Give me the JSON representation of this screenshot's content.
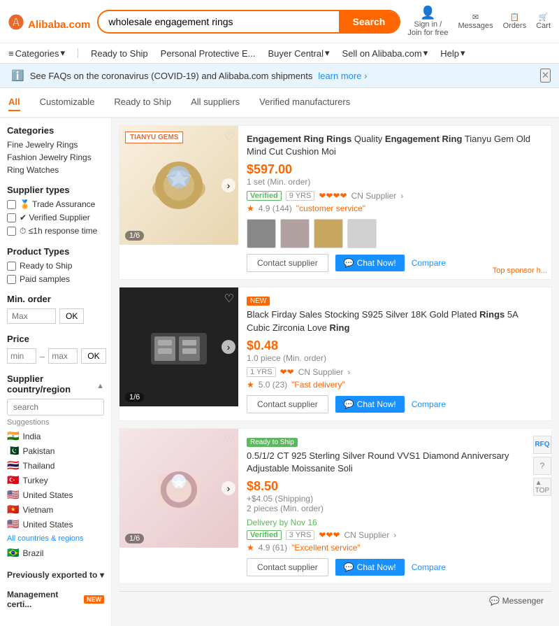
{
  "header": {
    "logo": "Alibaba.com",
    "search_placeholder": "wholesale engagement rings",
    "search_btn": "Search",
    "actions": [
      {
        "label": "Sign in",
        "sublabel": "Join for free",
        "icon": "user-icon"
      },
      {
        "label": "Messages",
        "icon": "message-icon"
      },
      {
        "label": "Orders",
        "icon": "orders-icon"
      },
      {
        "label": "Cart",
        "icon": "cart-icon"
      }
    ]
  },
  "nav": {
    "items": [
      {
        "label": "Categories",
        "has_arrow": true
      },
      {
        "label": "Ready to Ship"
      },
      {
        "label": "Personal Protective E..."
      },
      {
        "label": "Buyer Central",
        "has_arrow": true
      },
      {
        "label": "Sell on Alibaba.com",
        "has_arrow": true
      },
      {
        "label": "Help",
        "has_arrow": true
      }
    ]
  },
  "banner": {
    "text": "See FAQs on the coronavirus (COVID-19) and Alibaba.com shipments",
    "link": "learn more ›"
  },
  "tabs": [
    {
      "label": "All",
      "active": true
    },
    {
      "label": "Customizable"
    },
    {
      "label": "Ready to Ship"
    },
    {
      "label": "All suppliers"
    },
    {
      "label": "Verified manufacturers"
    }
  ],
  "sidebar": {
    "categories_title": "Categories",
    "categories": [
      "Fine Jewelry Rings",
      "Fashion Jewelry Rings",
      "Ring Watches"
    ],
    "supplier_types_title": "Supplier types",
    "supplier_types": [
      {
        "label": "🏅 Trade Assurance"
      },
      {
        "label": "✔ Verified Supplier"
      },
      {
        "label": "⏱ ≤1h response time"
      }
    ],
    "product_types_title": "Product Types",
    "product_types": [
      {
        "label": "Ready to Ship"
      },
      {
        "label": "Paid samples"
      }
    ],
    "min_order_title": "Min. order",
    "min_order_placeholder": "Max",
    "min_order_ok": "OK",
    "price_title": "Price",
    "price_min": "min",
    "price_max": "max",
    "price_ok": "OK",
    "country_title": "Supplier country/region",
    "country_search_placeholder": "search",
    "suggestions_label": "Suggestions",
    "countries": [
      {
        "flag": "🇮🇳",
        "name": "India"
      },
      {
        "flag": "🇵🇰",
        "name": "Pakistan"
      },
      {
        "flag": "🇹🇭",
        "name": "Thailand"
      },
      {
        "flag": "🇹🇷",
        "name": "Turkey"
      },
      {
        "flag": "🇺🇸",
        "name": "United States"
      },
      {
        "flag": "🇻🇳",
        "name": "Vietnam"
      },
      {
        "flag": "🇺🇸",
        "name": "United States"
      }
    ],
    "all_regions": "All countries & regions",
    "extra_country": {
      "flag": "🇧🇷",
      "name": "Brazil"
    },
    "prev_exported": "Previously exported to",
    "mgmt_cert": "Management certi...",
    "new_label": "NEW"
  },
  "products": [
    {
      "id": 1,
      "brand_logo": "TIANYU GEMS",
      "title": "Engagement Ring Rings Quality Engagement Ring Tianyu Gem Old Mind Cut Cushion Moi",
      "title_bold": [
        "Engagement Ring Rings",
        "Engagement Ring"
      ],
      "price": "$597.00",
      "moq": "1 set (Min. order)",
      "verified": "Verified",
      "years": "9 YRS",
      "hearts": "❤❤❤❤",
      "supplier": "CN Supplier",
      "rating": "4.9 (144)",
      "review_tag": "\"customer service\"",
      "thumbs": 4,
      "img_counter": "1/6",
      "top_sponsor": "Top sponsor h...",
      "actions": {
        "contact": "Contact supplier",
        "chat": "Chat Now!",
        "compare": "Compare"
      }
    },
    {
      "id": 2,
      "badge": "NEW",
      "title": "Black Firday Sales Stocking S925 Silver 18K Gold Plated Rings 5A Cubic Zirconia Love Ring",
      "title_bold": [
        "Rings",
        "Ring"
      ],
      "price": "$0.48",
      "moq": "1.0 piece (Min. order)",
      "years": "1 YRS",
      "hearts": "❤❤",
      "supplier": "CN Supplier",
      "rating": "5.0 (23)",
      "review_tag": "\"Fast delivery\"",
      "img_counter": "1/6",
      "actions": {
        "contact": "Contact supplier",
        "chat": "Chat Now!",
        "compare": "Compare"
      }
    },
    {
      "id": 3,
      "ready_ship": "Ready to Ship",
      "title": "0.5/1/2 CT 925 Sterling Silver Round VVS1 Diamond Anniversary Adjustable Moissanite Soli",
      "price": "$8.50",
      "shipping": "+$4.05 (Shipping)",
      "moq": "2 pieces (Min. order)",
      "delivery": "Delivery by Nov 16",
      "verified": "Verified",
      "years": "3 YRS",
      "hearts": "❤❤❤",
      "supplier": "CN Supplier",
      "rating": "4.9 (61)",
      "review_tag": "\"Excellent service\"",
      "img_counter": "1/6",
      "actions": {
        "contact": "Contact supplier",
        "chat": "Chat Now!",
        "compare": "Compare"
      },
      "side_icons": [
        "rfq",
        "question",
        "top"
      ]
    }
  ],
  "messenger": "Messenger"
}
